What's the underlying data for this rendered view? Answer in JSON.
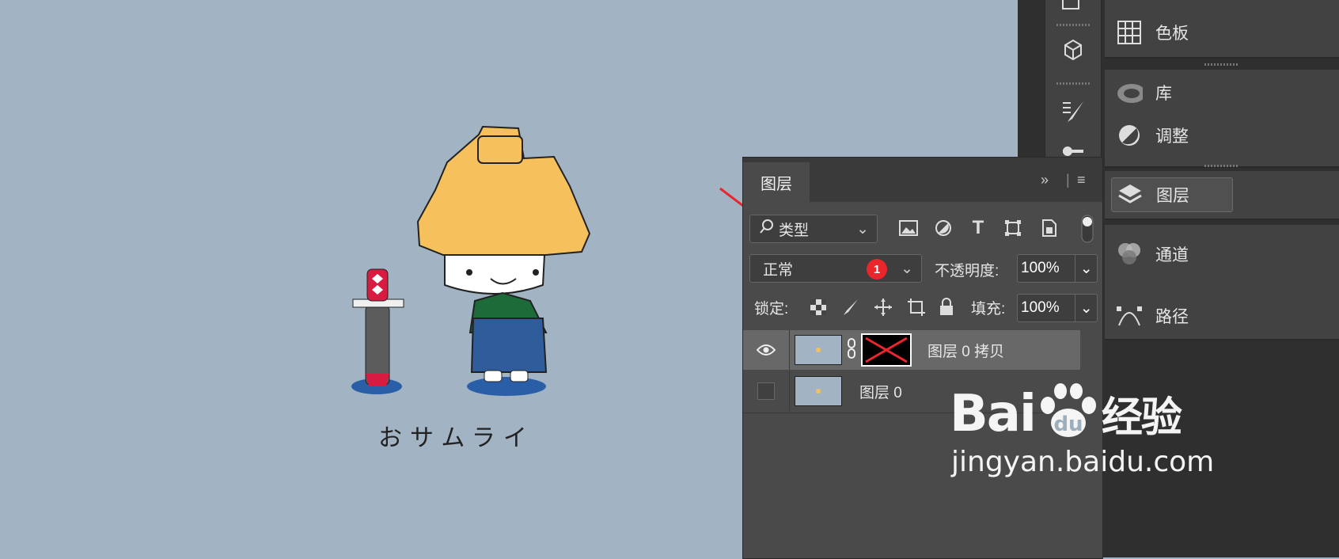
{
  "canvas": {
    "caption": "おサムライ"
  },
  "dock": {
    "items": [
      {
        "label": "色板",
        "icon": "swatches-grid-icon"
      },
      {
        "label": "库",
        "icon": "cloud-library-icon"
      },
      {
        "label": "调整",
        "icon": "adjustment-circle-icon"
      },
      {
        "label": "图层",
        "icon": "layers-stack-icon",
        "active": true
      },
      {
        "label": "通道",
        "icon": "channels-circles-icon"
      },
      {
        "label": "路径",
        "icon": "pen-path-icon"
      }
    ]
  },
  "layers_panel": {
    "tab_label": "图层",
    "filter_label": "类型",
    "blend_mode": "正常",
    "badge": "1",
    "opacity_label": "不透明度:",
    "opacity_value": "100%",
    "lock_label": "锁定:",
    "fill_label": "填充:",
    "fill_value": "100%",
    "layers": [
      {
        "name": "图层 0 拷贝",
        "visible": true,
        "has_mask": true,
        "selected": true
      },
      {
        "name": "图层 0",
        "visible": false,
        "has_mask": false,
        "selected": false
      }
    ]
  },
  "watermark": {
    "brand": "Bai",
    "brand_cn": "经验",
    "url": "jingyan.baidu.com"
  },
  "colors": {
    "canvas_bg": "#a2b4c4",
    "panel_bg": "#4a4a4a",
    "accent_red": "#e8262c"
  }
}
